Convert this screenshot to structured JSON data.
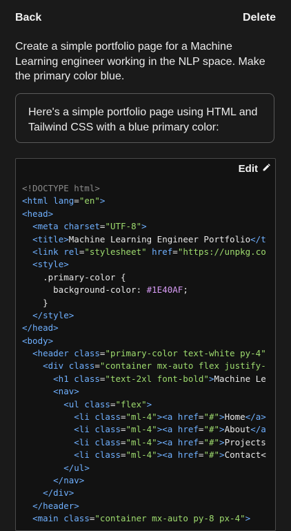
{
  "topbar": {
    "back_label": "Back",
    "delete_label": "Delete"
  },
  "prompt_text": "Create a simple portfolio page for a Machine Learning engineer working in the NLP space. Make the primary color blue.",
  "response_text": "Here's a simple portfolio page using HTML and Tailwind CSS with a blue primary color:",
  "code_block": {
    "edit_label": "Edit",
    "edit_icon": "pencil-icon",
    "lines": [
      "<!DOCTYPE html>",
      "<html lang=\"en\">",
      "<head>",
      "  <meta charset=\"UTF-8\">",
      "  <title>Machine Learning Engineer Portfolio</t",
      "  <link rel=\"stylesheet\" href=\"https://unpkg.co",
      "  <style>",
      "    .primary-color {",
      "      background-color: #1E40AF;",
      "    }",
      "  </style>",
      "</head>",
      "<body>",
      "  <header class=\"primary-color text-white py-4\"",
      "    <div class=\"container mx-auto flex justify-",
      "      <h1 class=\"text-2xl font-bold\">Machine Le",
      "      <nav>",
      "        <ul class=\"flex\">",
      "          <li class=\"ml-4\"><a href=\"#\">Home</a>",
      "          <li class=\"ml-4\"><a href=\"#\">About</a",
      "          <li class=\"ml-4\"><a href=\"#\">Projects",
      "          <li class=\"ml-4\"><a href=\"#\">Contact<",
      "        </ul>",
      "      </nav>",
      "    </div>",
      "  </header>",
      "  <main class=\"container mx-auto py-8 px-4\">"
    ]
  },
  "colors": {
    "background": "#1a1a1a",
    "code_background": "#121212",
    "tag": "#6fb0ff",
    "string": "#9edb6e",
    "comment": "#8a8a8a",
    "hex_value": "#d89cf6"
  }
}
